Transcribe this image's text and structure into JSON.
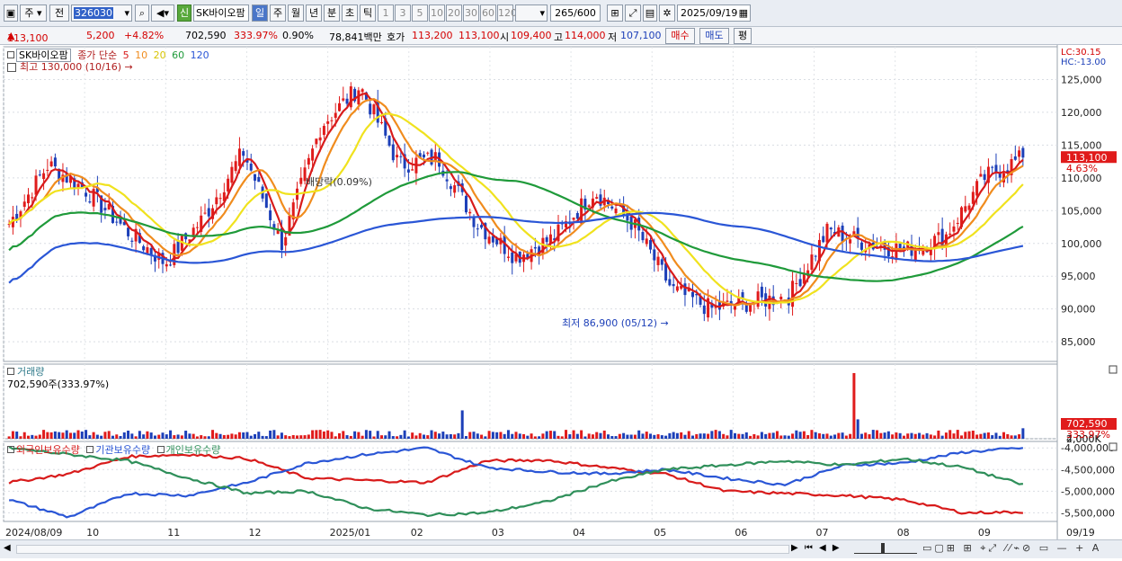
{
  "toolbar": {
    "code_label": "주",
    "prev_label": "전",
    "stock_code": "326030",
    "sin_badge": "신",
    "stock_name": "SK바이오팜",
    "periods": [
      "일",
      "주",
      "월",
      "년",
      "분",
      "초",
      "틱"
    ],
    "active_period": "일",
    "intervals": [
      "1",
      "3",
      "5",
      "10",
      "20",
      "30",
      "60",
      "120"
    ],
    "count": "265",
    "count_total": "/600",
    "date": "2025/09/19"
  },
  "info": {
    "price": "113,100",
    "change": "5,200",
    "change_pct": "+4.82%",
    "volume": "702,590",
    "volume_ratio": "333.97%",
    "turnover": "0.90%",
    "amount": "78,841백만",
    "quote_label": "호가",
    "ask": "113,200",
    "bid": "113,100",
    "open_label": "시",
    "open": "109,400",
    "high_label": "고",
    "high": "114,000",
    "low_label": "저",
    "low": "107,100",
    "buy_label": "매수",
    "sell_label": "매도",
    "avg_label": "평"
  },
  "price_panel": {
    "stock_name": "SK바이오팜",
    "series_label": "종가 단순",
    "ma_periods": [
      "5",
      "10",
      "20",
      "60",
      "120"
    ],
    "ma_colors": [
      "#d81b1b",
      "#f08c1e",
      "#f0e21e",
      "#1f9a3a",
      "#2a56d6"
    ],
    "high_note": "최고 130,000 (10/16)",
    "low_note": "최저 86,900 (05/12)",
    "dividend_note": "배당락(0.09%)",
    "lc": "LC:30.15",
    "hc": "HC:-13.00",
    "current_price_tag": "113,100",
    "current_pct_tag": "4.63%",
    "y_ticks": [
      "125,000",
      "120,000",
      "115,000",
      "110,000",
      "105,000",
      "100,000",
      "95,000",
      "90,000",
      "85,000"
    ]
  },
  "volume_panel": {
    "title": "거래량",
    "value": "702,590주(333.97%)",
    "y_ticks": [
      "4,000K",
      "2,000K"
    ],
    "tag_value": "702,590",
    "tag_pct": "333.97%"
  },
  "holding_panel": {
    "labels": [
      "외국인보유수량",
      "기관보유수량",
      "개인보유수량"
    ],
    "colors": [
      "#d81b1b",
      "#2a56d6",
      "#2f8f5a"
    ],
    "y_ticks": [
      "-4,000,000",
      "-4,500,000",
      "-5,000,000",
      "-5,500,000"
    ]
  },
  "x_axis": [
    "2024/08/09",
    "10",
    "11",
    "12",
    "2025/01",
    "02",
    "03",
    "04",
    "05",
    "06",
    "07",
    "08",
    "09",
    "09/19"
  ],
  "chart_data": [
    {
      "type": "candlestick",
      "title": "SK바이오팜",
      "x": [
        "2024/08/09",
        "10",
        "11",
        "12",
        "2025/01",
        "02",
        "03",
        "04",
        "05",
        "06",
        "07",
        "08",
        "09",
        "09/19"
      ],
      "close_path": [
        103000,
        112000,
        108000,
        102000,
        97000,
        104000,
        114000,
        100000,
        118000,
        124000,
        112000,
        113000,
        103000,
        98000,
        101000,
        108000,
        103000,
        93000,
        90000,
        91000,
        92000,
        102000,
        100000,
        99000,
        101000,
        110000,
        113100
      ],
      "ylim": [
        82000,
        130000
      ],
      "high": 130000,
      "low": 86900
    },
    {
      "type": "bar",
      "title": "거래량",
      "last_value": 702590,
      "ylim": [
        0,
        5000000
      ]
    },
    {
      "type": "line",
      "series": [
        {
          "name": "외국인보유수량",
          "values": [
            -4800000,
            -4600000,
            -4200000,
            -4150000,
            -4250000,
            -4700000,
            -4750000,
            -4800000,
            -4300000,
            -4280000,
            -4450000,
            -4600000,
            -5000000,
            -5050000,
            -5100000,
            -5200000,
            -5500000,
            -5480000
          ]
        },
        {
          "name": "기관보유수량",
          "values": [
            -5200000,
            -5600000,
            -5050000,
            -5100000,
            -4800000,
            -4350000,
            -4150000,
            -4000000,
            -4450000,
            -4550000,
            -4600000,
            -4500000,
            -4700000,
            -4850000,
            -4400000,
            -4350000,
            -4100000,
            -4000000
          ]
        },
        {
          "name": "개인보유수량",
          "values": [
            -4000000,
            -4150000,
            -4300000,
            -4700000,
            -5050000,
            -5000000,
            -5400000,
            -5550000,
            -5500000,
            -5250000,
            -4800000,
            -4500000,
            -4400000,
            -4300000,
            -4400000,
            -4250000,
            -4450000,
            -4850000
          ]
        }
      ],
      "ylim": [
        -5700000,
        -3850000
      ]
    }
  ]
}
